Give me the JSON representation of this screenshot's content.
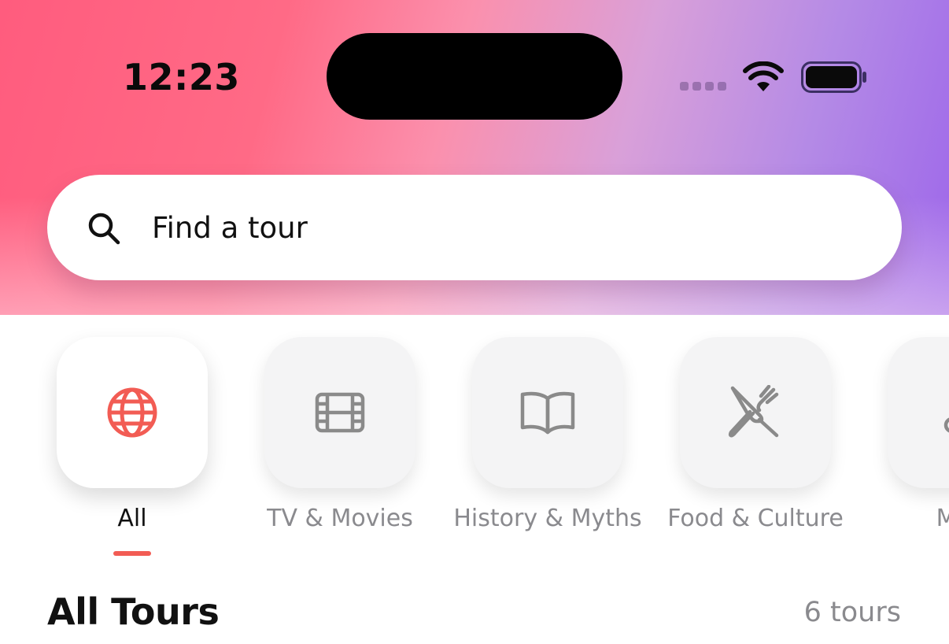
{
  "status_bar": {
    "time": "12:23"
  },
  "search": {
    "placeholder": "Find a tour",
    "icon": "search-icon"
  },
  "categories": [
    {
      "label": "All",
      "icon": "globe-icon",
      "active": true,
      "icon_color": "#f25c54"
    },
    {
      "label": "TV & Movies",
      "icon": "film-icon",
      "active": false,
      "icon_color": "#8a8a8a"
    },
    {
      "label": "History & Myths",
      "icon": "book-icon",
      "active": false,
      "icon_color": "#8a8a8a"
    },
    {
      "label": "Food & Culture",
      "icon": "utensils-icon",
      "active": false,
      "icon_color": "#8a8a8a"
    },
    {
      "label": "Musi",
      "icon": "music-icon",
      "active": false,
      "icon_color": "#8a8a8a"
    }
  ],
  "section": {
    "title": "All Tours",
    "count": "6 tours"
  },
  "colors": {
    "accent": "#f25c54",
    "gradient_start": "#ff5c7e",
    "gradient_end": "#9d66ea"
  }
}
